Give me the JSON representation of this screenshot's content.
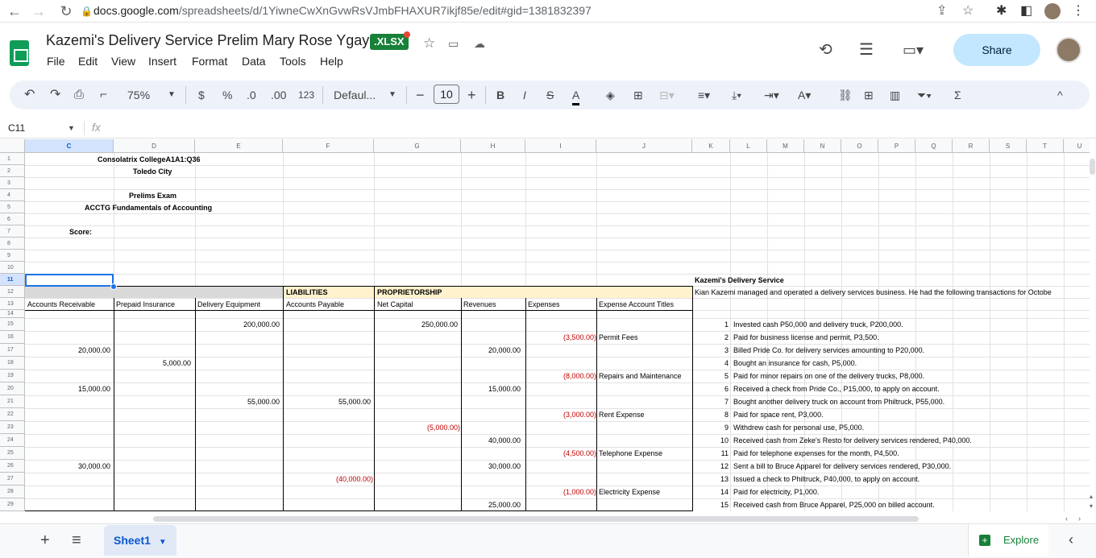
{
  "browser": {
    "host": "docs.google.com",
    "path": "/spreadsheets/d/1YiwneCwXnGvwRsVJmbFHAXUR7ikjf85e/edit#gid=1381832397"
  },
  "doc": {
    "title": "Kazemi's Delivery Service Prelim Mary Rose Ygay",
    "badge": ".XLSX",
    "share": "Share"
  },
  "menu": [
    "File",
    "Edit",
    "View",
    "Insert",
    "Format",
    "Data",
    "Tools",
    "Help"
  ],
  "toolbar": {
    "zoom": "75%",
    "currency": "$",
    "percent": "%",
    "dec_less": ".0",
    "dec_more": ".00",
    "number_format": "123",
    "font": "Defaul...",
    "font_size": "10",
    "bold": "B",
    "italic": "I"
  },
  "formula": {
    "namebox": "C11",
    "fx": "fx"
  },
  "columns": [
    "C",
    "D",
    "E",
    "F",
    "G",
    "H",
    "I",
    "J",
    "K",
    "L",
    "M",
    "N",
    "O",
    "P",
    "Q",
    "R",
    "S",
    "T",
    "U"
  ],
  "rows": [
    "1",
    "2",
    "3",
    "4",
    "5",
    "6",
    "7",
    "8",
    "9",
    "10",
    "11",
    "12",
    "13",
    "14",
    "15",
    "16",
    "17",
    "18",
    "19",
    "20",
    "21",
    "22",
    "23",
    "24",
    "25",
    "26",
    "27",
    "28",
    "29"
  ],
  "header_text": {
    "school": "Consolatrix CollegeA1A1:Q36",
    "city": "Toledo City",
    "exam": "Prelims Exam",
    "course": "ACCTG Fundamentals of Accounting",
    "score": "Score:"
  },
  "group_labels": {
    "liabilities": "LIABILITIES",
    "proprietorship": "PROPRIETORSHIP"
  },
  "col_headers": {
    "c": "Accounts Receivable",
    "d": "Prepaid Insurance",
    "e": "Delivery Equipment",
    "f": "Accounts Payable",
    "g": "Net Capital",
    "h": "Revenues",
    "i": "Expenses",
    "j": "Expense Account Titles"
  },
  "ledger": {
    "r15": {
      "e": "200,000.00",
      "g": "250,000.00"
    },
    "r16": {
      "i": "(3,500.00)",
      "j": "Permit Fees"
    },
    "r17": {
      "c": "20,000.00",
      "h": "20,000.00"
    },
    "r18": {
      "d": "5,000.00"
    },
    "r19": {
      "i": "(8,000.00)",
      "j": "Repairs and Maintenance"
    },
    "r20": {
      "c": "15,000.00",
      "h": "15,000.00"
    },
    "r21": {
      "e": "55,000.00",
      "f": "55,000.00"
    },
    "r22": {
      "i": "(3,000.00)",
      "j": "Rent Expense"
    },
    "r23": {
      "g": "(5,000.00)"
    },
    "r24": {
      "h": "40,000.00"
    },
    "r25": {
      "i": "(4,500.00)",
      "j": "Telephone Expense"
    },
    "r26": {
      "c": "30,000.00",
      "h": "30,000.00"
    },
    "r27": {
      "f": "(40,000.00)"
    },
    "r28": {
      "i": "(1,000.00)",
      "j": "Electricity Expense"
    },
    "r29": {
      "h": "25,000.00"
    }
  },
  "problem": {
    "title": "Kazemi's Delivery Service",
    "intro": "Kian Kazemi managed and operated a delivery services business. He had the following transactions for Octobe",
    "items": [
      {
        "n": "1",
        "t": "Invested cash P50,000 and delivery truck, P200,000."
      },
      {
        "n": "2",
        "t": "Paid for business license and permit, P3,500."
      },
      {
        "n": "3",
        "t": "Billed Pride Co. for delivery services amounting to P20,000."
      },
      {
        "n": "4",
        "t": "Bought an insurance for cash, P5,000."
      },
      {
        "n": "5",
        "t": "Paid for minor repairs on one of the delivery trucks, P8,000."
      },
      {
        "n": "6",
        "t": "Received a check from Pride Co., P15,000, to apply on account."
      },
      {
        "n": "7",
        "t": "Bought another delivery truck on account from Philtruck, P55,000."
      },
      {
        "n": "8",
        "t": "Paid for space rent, P3,000."
      },
      {
        "n": "9",
        "t": "Withdrew cash for personal use, P5,000."
      },
      {
        "n": "10",
        "t": "Received cash from Zeke's Resto for delivery services rendered, P40,000."
      },
      {
        "n": "11",
        "t": "Paid for telephone expenses for the month, P4,500."
      },
      {
        "n": "12",
        "t": "Sent a bill to Bruce Apparel for delivery services rendered, P30,000."
      },
      {
        "n": "13",
        "t": "Issued a check to Philtruck, P40,000, to apply on account."
      },
      {
        "n": "14",
        "t": "Paid for electricity, P1,000."
      },
      {
        "n": "15",
        "t": "Received cash from Bruce Apparel, P25,000 on billed account."
      }
    ]
  },
  "footer": {
    "sheet": "Sheet1",
    "explore": "Explore",
    "add": "+",
    "list": "≡"
  },
  "colors": {
    "accent": "#0b57d0",
    "green": "#188038",
    "negative": "#c00000",
    "highlight": "#fff2cc",
    "gray_band": "#d9d9d9"
  }
}
